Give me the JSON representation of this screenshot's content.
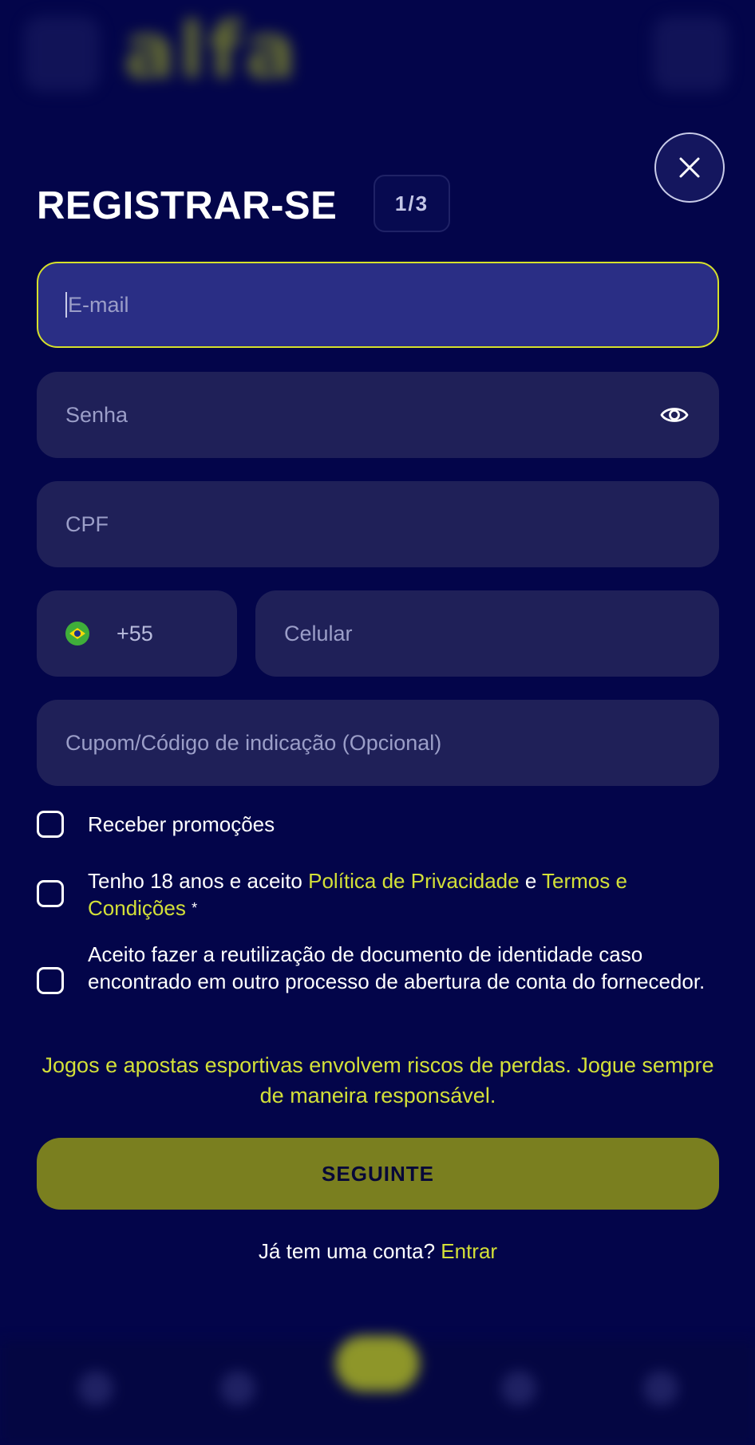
{
  "background": {
    "logo_text": "alfa"
  },
  "modal": {
    "title": "REGISTRAR-SE",
    "step": "1/3",
    "close_icon": "close-icon"
  },
  "form": {
    "email": {
      "placeholder": "E-mail",
      "value": ""
    },
    "password": {
      "placeholder": "Senha",
      "value": "",
      "icon": "eye-icon"
    },
    "cpf": {
      "placeholder": "CPF",
      "value": ""
    },
    "phone": {
      "country_flag": "brazil-flag-icon",
      "country_code": "+55",
      "placeholder": "Celular",
      "value": ""
    },
    "coupon": {
      "placeholder": "Cupom/Código de indicação (Opcional)",
      "value": ""
    }
  },
  "checkboxes": {
    "promotions": {
      "label": "Receber promoções",
      "checked": false
    },
    "terms": {
      "text_before": "Tenho 18 anos e aceito ",
      "privacy_link": "Política de Privacidade",
      "and": " e ",
      "terms_link": "Termos e Condições",
      "required_mark": "*",
      "checked": false
    },
    "document_reuse": {
      "label": "Aceito fazer a reutilização de documento de identidade caso encontrado em outro processo de abertura de conta do fornecedor.",
      "checked": false
    }
  },
  "warning_text": "Jogos e apostas esportivas envolvem riscos de perdas. Jogue sempre de maneira responsável.",
  "next_button": "SEGUINTE",
  "login": {
    "prompt": "Já tem uma conta? ",
    "link": "Entrar"
  },
  "colors": {
    "background": "#03054a",
    "field": "#1f2058",
    "accent": "#d3e038",
    "button": "#7a7f1f"
  }
}
